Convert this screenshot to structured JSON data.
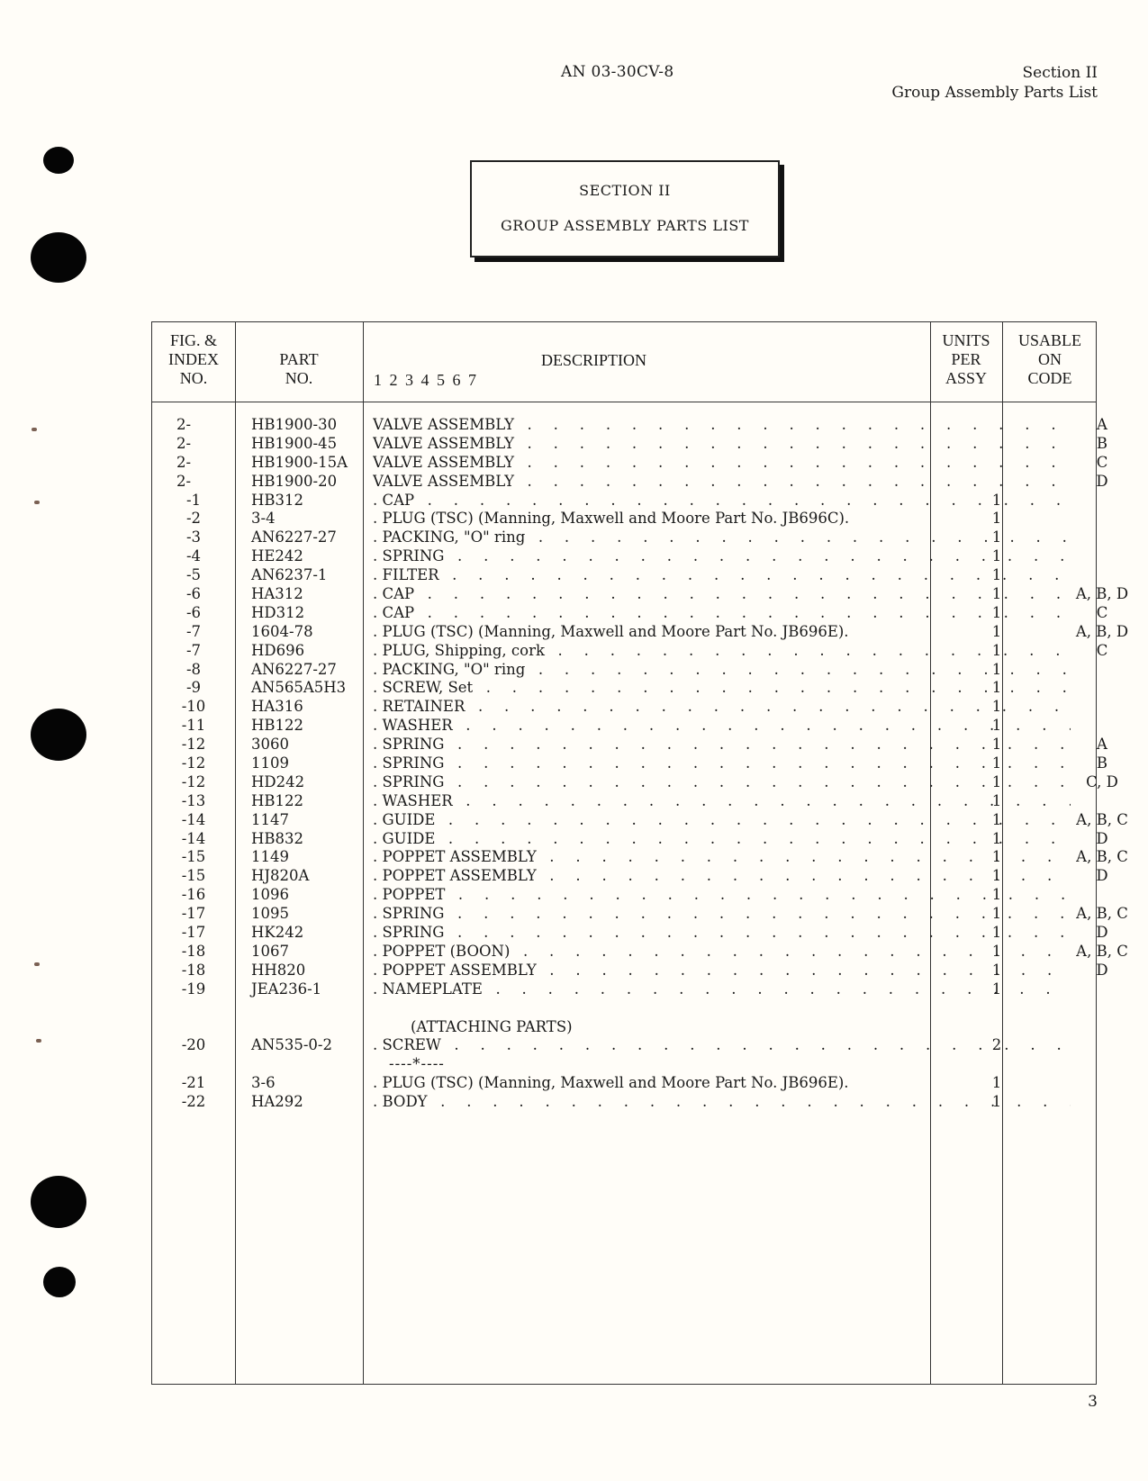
{
  "header": {
    "doc_number": "AN 03-30CV-8",
    "section_line1": "Section II",
    "section_line2": "Group Assembly Parts List"
  },
  "title_box": {
    "line1": "SECTION II",
    "line2": "GROUP ASSEMBLY PARTS LIST"
  },
  "table": {
    "columns": {
      "index": [
        "FIG. &",
        "INDEX",
        "NO."
      ],
      "part": [
        "PART",
        "NO."
      ],
      "description": "DESCRIPTION",
      "description_indent_levels": "1 2 3 4 5 6 7",
      "units": [
        "UNITS",
        "PER",
        "ASSY"
      ],
      "usable": [
        "USABLE",
        "ON",
        "CODE"
      ]
    },
    "rows": [
      {
        "index": "2-",
        "part": "HB1900-30",
        "desc": "VALVE ASSEMBLY",
        "units": "",
        "code": "A",
        "top": true
      },
      {
        "index": "2-",
        "part": "HB1900-45",
        "desc": "VALVE ASSEMBLY",
        "units": "",
        "code": "B",
        "top": true
      },
      {
        "index": "2-",
        "part": "HB1900-15A",
        "desc": "VALVE ASSEMBLY",
        "units": "",
        "code": "C",
        "top": true
      },
      {
        "index": "2-",
        "part": "HB1900-20",
        "desc": "VALVE ASSEMBLY",
        "units": "",
        "code": "D",
        "top": true
      },
      {
        "index": "-1",
        "part": "HB312",
        "desc": ". CAP",
        "units": "1",
        "code": ""
      },
      {
        "index": "-2",
        "part": "3-4",
        "desc": ". PLUG (TSC) (Manning, Maxwell and Moore Part No. JB696C).",
        "units": "1",
        "code": "",
        "nodots": true
      },
      {
        "index": "-3",
        "part": "AN6227-27",
        "desc": ". PACKING, \"O\" ring",
        "units": "1",
        "code": ""
      },
      {
        "index": "-4",
        "part": "HE242",
        "desc": ". SPRING",
        "units": "1",
        "code": ""
      },
      {
        "index": "-5",
        "part": "AN6237-1",
        "desc": ". FILTER",
        "units": "1",
        "code": ""
      },
      {
        "index": "-6",
        "part": "HA312",
        "desc": ". CAP",
        "units": "1",
        "code": "A, B, D"
      },
      {
        "index": "-6",
        "part": "HD312",
        "desc": ". CAP",
        "units": "1",
        "code": "C"
      },
      {
        "index": "-7",
        "part": "1604-78",
        "desc": ". PLUG (TSC) (Manning, Maxwell and Moore Part No. JB696E).",
        "units": "1",
        "code": "A, B, D",
        "nodots": true
      },
      {
        "index": "-7",
        "part": "HD696",
        "desc": ". PLUG, Shipping, cork",
        "units": "1",
        "code": "C"
      },
      {
        "index": "-8",
        "part": "AN6227-27",
        "desc": ". PACKING, \"O\" ring",
        "units": "1",
        "code": ""
      },
      {
        "index": "-9",
        "part": "AN565A5H3",
        "desc": ". SCREW, Set",
        "units": "1",
        "code": ""
      },
      {
        "index": "-10",
        "part": "HA316",
        "desc": ". RETAINER",
        "units": "1",
        "code": ""
      },
      {
        "index": "-11",
        "part": "HB122",
        "desc": ". WASHER",
        "units": "1",
        "code": ""
      },
      {
        "index": "-12",
        "part": "3060",
        "desc": ". SPRING",
        "units": "1",
        "code": "A"
      },
      {
        "index": "-12",
        "part": "1109",
        "desc": ". SPRING",
        "units": "1",
        "code": "B"
      },
      {
        "index": "-12",
        "part": "HD242",
        "desc": ". SPRING",
        "units": "1",
        "code": "C, D"
      },
      {
        "index": "-13",
        "part": "HB122",
        "desc": ". WASHER",
        "units": "1",
        "code": ""
      },
      {
        "index": "-14",
        "part": "1147",
        "desc": ". GUIDE",
        "units": "1",
        "code": "A, B, C"
      },
      {
        "index": "-14",
        "part": "HB832",
        "desc": ". GUIDE",
        "units": "1",
        "code": "D"
      },
      {
        "index": "-15",
        "part": "1149",
        "desc": ". POPPET ASSEMBLY",
        "units": "1",
        "code": "A, B, C"
      },
      {
        "index": "-15",
        "part": "HJ820A",
        "desc": ". POPPET ASSEMBLY",
        "units": "1",
        "code": "D"
      },
      {
        "index": "-16",
        "part": "1096",
        "desc": ". POPPET",
        "units": "1",
        "code": ""
      },
      {
        "index": "-17",
        "part": "1095",
        "desc": ". SPRING",
        "units": "1",
        "code": "A, B, C"
      },
      {
        "index": "-17",
        "part": "HK242",
        "desc": ". SPRING",
        "units": "1",
        "code": "D"
      },
      {
        "index": "-18",
        "part": "1067",
        "desc": ". POPPET (BOON)",
        "units": "1",
        "code": "A, B, C"
      },
      {
        "index": "-18",
        "part": "HH820",
        "desc": ". POPPET ASSEMBLY",
        "units": "1",
        "code": "D"
      },
      {
        "index": "-19",
        "part": "JEA236-1",
        "desc": ". NAMEPLATE",
        "units": "1",
        "code": ""
      },
      {
        "spacer": true
      },
      {
        "subhead": "(ATTACHING PARTS)"
      },
      {
        "index": "-20",
        "part": "AN535-0-2",
        "desc": ". SCREW",
        "units": "2",
        "code": ""
      },
      {
        "separator": "----*----"
      },
      {
        "index": "-21",
        "part": "3-6",
        "desc": ". PLUG (TSC) (Manning, Maxwell and Moore Part No. JB696E).",
        "units": "1",
        "code": "",
        "nodots": true
      },
      {
        "index": "-22",
        "part": "HA292",
        "desc": ". BODY",
        "units": "1",
        "code": ""
      }
    ]
  },
  "footer": {
    "page_number": "3"
  }
}
